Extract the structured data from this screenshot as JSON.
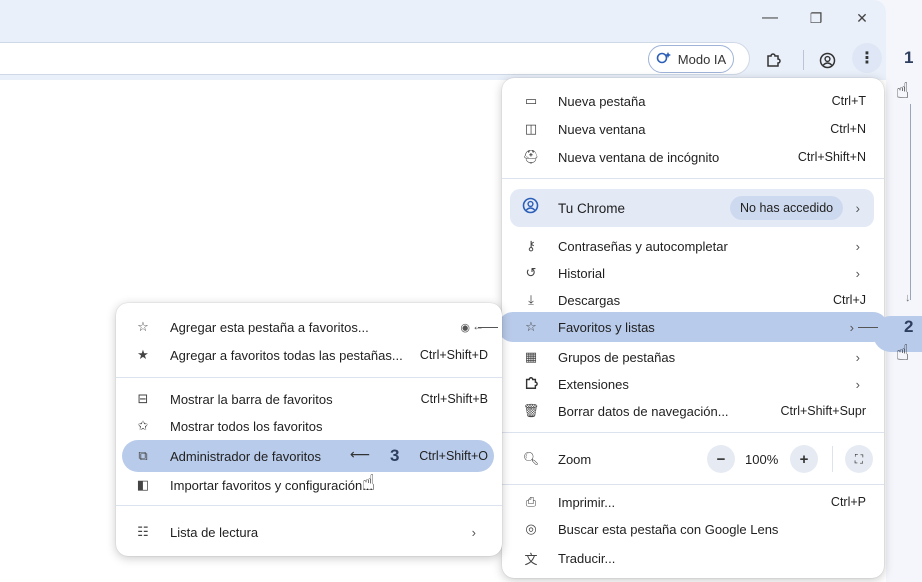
{
  "window": {
    "controls": {
      "minimize": "—",
      "maximize": "❐",
      "close": "✕"
    }
  },
  "toolbar": {
    "modo_ia_label": "Modo IA",
    "extensions_icon": "puzzle-icon",
    "profile_icon": "profile-icon",
    "menu_icon": "⋮"
  },
  "steps": {
    "one": "1",
    "two": "2",
    "three": "3"
  },
  "main_menu": {
    "new_tab": {
      "label": "Nueva pestaña",
      "shortcut": "Ctrl+T"
    },
    "new_window": {
      "label": "Nueva ventana",
      "shortcut": "Ctrl+N"
    },
    "incognito": {
      "label": "Nueva ventana de incógnito",
      "shortcut": "Ctrl+Shift+N"
    },
    "tu_chrome": {
      "label": "Tu Chrome",
      "badge": "No has accedido"
    },
    "passwords": {
      "label": "Contraseñas y autocompletar"
    },
    "history": {
      "label": "Historial"
    },
    "downloads": {
      "label": "Descargas",
      "shortcut": "Ctrl+J"
    },
    "bookmarks": {
      "label": "Favoritos y listas"
    },
    "tab_groups": {
      "label": "Grupos de pestañas"
    },
    "extensions": {
      "label": "Extensiones"
    },
    "clear_data": {
      "label": "Borrar datos de navegación...",
      "shortcut": "Ctrl+Shift+Supr"
    },
    "zoom": {
      "label": "Zoom",
      "value": "100%",
      "minus": "−",
      "plus": "+"
    },
    "print": {
      "label": "Imprimir...",
      "shortcut": "Ctrl+P"
    },
    "lens": {
      "label": "Buscar esta pestaña con Google Lens"
    },
    "translate": {
      "label": "Traducir..."
    }
  },
  "sub_menu": {
    "add_tab": {
      "label": "Agregar esta pestaña a favoritos..."
    },
    "add_all": {
      "label": "Agregar a favoritos todas las pestañas...",
      "shortcut": "Ctrl+Shift+D"
    },
    "show_bar": {
      "label": "Mostrar la barra de favoritos",
      "shortcut": "Ctrl+Shift+B"
    },
    "show_all": {
      "label": "Mostrar todos los favoritos"
    },
    "manager": {
      "label": "Administrador de favoritos",
      "shortcut": "Ctrl+Shift+O"
    },
    "import": {
      "label": "Importar favoritos y configuración..."
    },
    "reading_list": {
      "label": "Lista de lectura"
    }
  },
  "colors": {
    "highlight": "#b9cbea",
    "toolbar_bg": "#eaf0fa",
    "accent": "#2c5fb8"
  }
}
